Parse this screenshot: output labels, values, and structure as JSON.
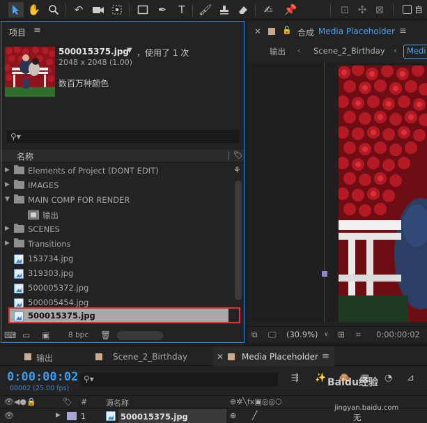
{
  "toolbar": {
    "tools": [
      "selection-tool",
      "hand-tool",
      "zoom-tool",
      "rotate-tool",
      "camera-tool",
      "pan-behind-tool",
      "rectangle-tool",
      "pen-tool",
      "type-tool",
      "brush-tool",
      "clone-stamp-tool",
      "eraser-tool",
      "roto-brush-tool",
      "puppet-tool"
    ],
    "checkbox_label": "自"
  },
  "project": {
    "title": "项目",
    "filename": "500015375.jpg",
    "used_label": "，使用了 1 次",
    "dimensions": "2048 x 2048 (1.00)",
    "colors": "数百万种颜色",
    "col_name": "名称",
    "items": [
      {
        "type": "folder",
        "label": "Elements of Project (DONT EDIT)",
        "expanded": false
      },
      {
        "type": "folder",
        "label": "IMAGES",
        "expanded": false
      },
      {
        "type": "folder",
        "label": "MAIN COMP FOR RENDER",
        "expanded": true
      },
      {
        "type": "comp",
        "label": "输出",
        "expanded": false
      },
      {
        "type": "folder",
        "label": "SCENES",
        "expanded": false
      },
      {
        "type": "folder",
        "label": "Transitions",
        "expanded": false
      },
      {
        "type": "image",
        "label": "153734.jpg"
      },
      {
        "type": "image",
        "label": "319303.jpg"
      },
      {
        "type": "image",
        "label": "500005372.jpg"
      },
      {
        "type": "image",
        "label": "500005454.jpg"
      },
      {
        "type": "image",
        "label": "500015375.jpg",
        "selected": true
      }
    ],
    "bpc": "8 bpc"
  },
  "composition": {
    "prefix": "合成",
    "name": "Media Placeholder",
    "crumbs": [
      "输出",
      "Scene_2_Birthday",
      "Medi"
    ],
    "zoom": "(30.9%)",
    "time": "0:00:00:02"
  },
  "timeline": {
    "tabs": [
      {
        "label": "输出",
        "color": "#c9a989"
      },
      {
        "label": "Scene_2_Birthday",
        "color": "#c9a989"
      },
      {
        "label": "Media Placeholder",
        "color": "#c9a989"
      }
    ],
    "timecode": "0:00:00:02",
    "fps": "00002 (25.00 fps)",
    "col_number": "#",
    "col_source": "源名称",
    "layer": {
      "number": "1",
      "name": "500015375.jpg",
      "mode": "无"
    }
  },
  "watermark": {
    "text": "Baidu经验",
    "url": "jingyan.baidu.com"
  }
}
